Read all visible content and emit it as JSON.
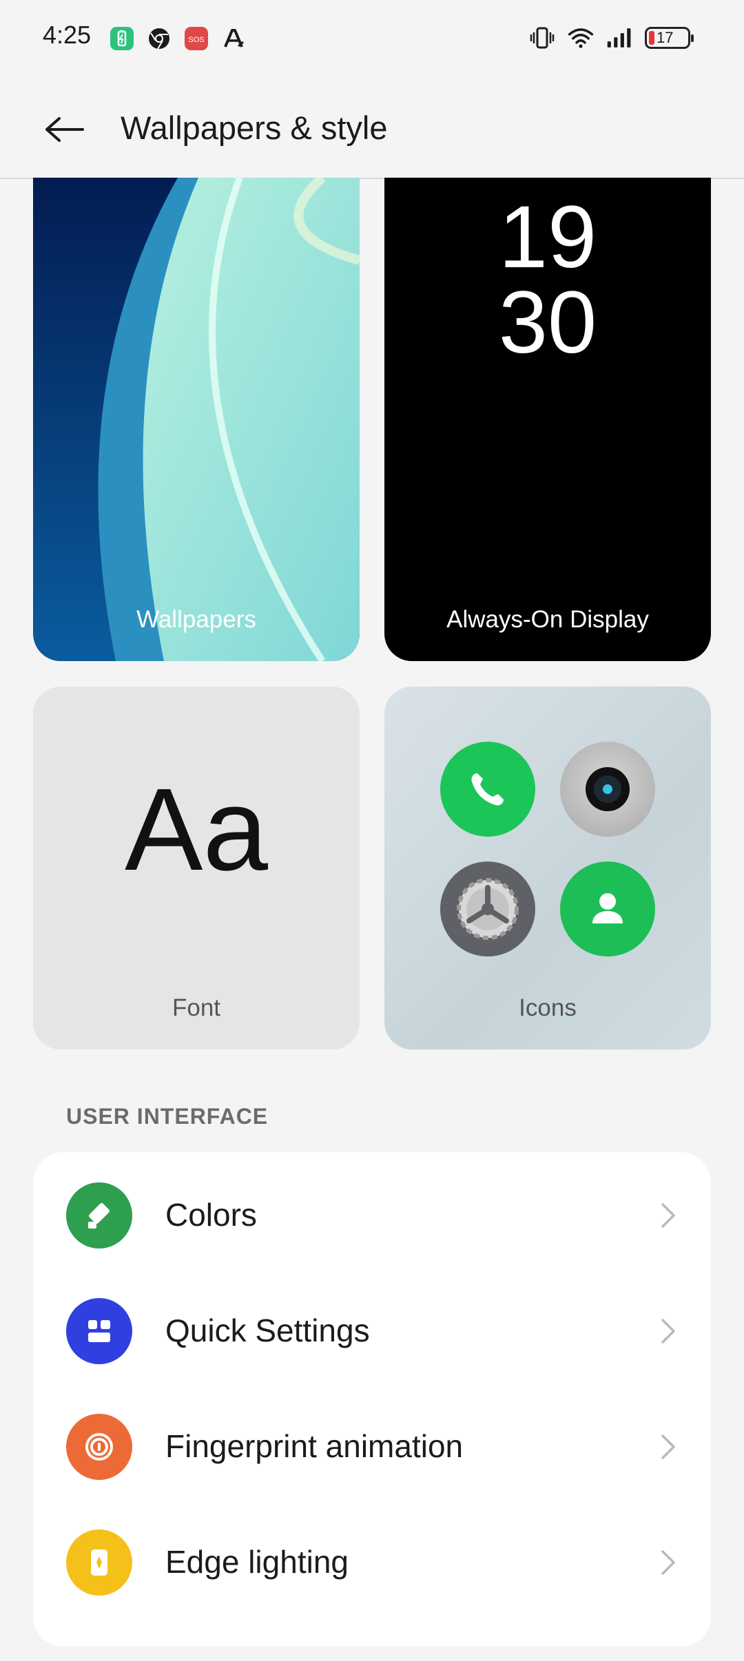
{
  "status_bar": {
    "time": "4:25",
    "notification_icons": [
      "battery-saver-icon",
      "chrome-icon",
      "sos-icon",
      "a-app-icon"
    ],
    "sos_text": "SOS",
    "status_icons": [
      "vibrate-icon",
      "wifi-icon",
      "signal-icon",
      "battery-icon"
    ],
    "battery_level": "17",
    "battery_color": "#e5353b"
  },
  "header": {
    "title": "Wallpapers & style",
    "back_icon": "back-arrow-icon"
  },
  "tiles": {
    "wallpapers": {
      "label": "Wallpapers"
    },
    "aod": {
      "label": "Always-On Display",
      "clock_hour": "19",
      "clock_minute": "30"
    },
    "font": {
      "label": "Font",
      "sample": "Aa"
    },
    "icons": {
      "label": "Icons",
      "preview_icons": [
        "phone-icon",
        "camera-icon",
        "settings-icon",
        "contacts-icon"
      ]
    }
  },
  "user_interface": {
    "section_title": "USER INTERFACE",
    "items": [
      {
        "label": "Colors",
        "icon": "paint-bucket-icon",
        "color": "#2e9e4f"
      },
      {
        "label": "Quick Settings",
        "icon": "quick-settings-icon",
        "color": "#2f3fe0"
      },
      {
        "label": "Fingerprint animation",
        "icon": "fingerprint-icon",
        "color": "#ec6a35"
      },
      {
        "label": "Edge lighting",
        "icon": "edge-lighting-icon",
        "color": "#f5c01a"
      }
    ]
  }
}
